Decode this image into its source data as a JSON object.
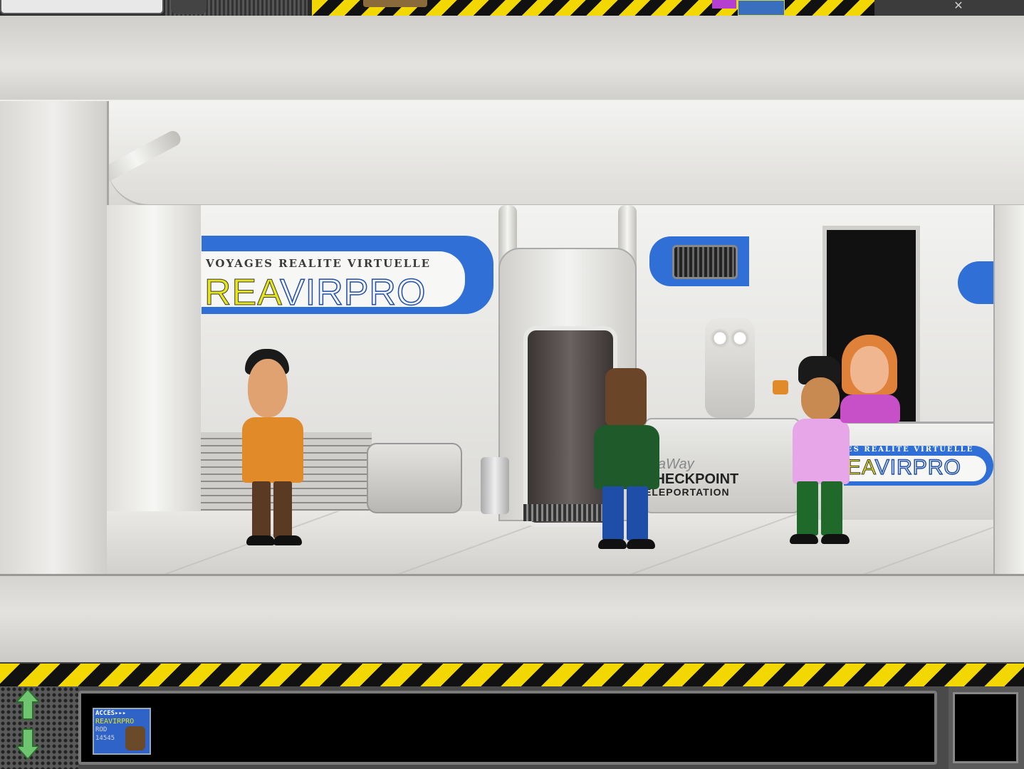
{
  "scene": {
    "sign_left": {
      "subtitle": "VOYAGES REALITE VIRTUELLE",
      "logo_part_1": "REA",
      "logo_part_2": "VIRPRO"
    },
    "sign_right": {
      "subtitle": "ES REALITE VIRTUELLE",
      "logo_part_1": "EA",
      "logo_part_2": "VIRPRO"
    },
    "checkpoint": {
      "brand": "StaWay",
      "title": "CHECKPOINT",
      "subtitle": "ELEPORTATION"
    }
  },
  "inventory": {
    "items": [
      {
        "line1": "ACCES▸▸▸",
        "line2": "REAVIRPRO",
        "line3": "ROD",
        "line4": "14545"
      }
    ]
  },
  "colors": {
    "hazard_yellow": "#f2d800",
    "sign_blue": "#2f6fd6",
    "logo_yellow": "#e5e51a"
  },
  "icons": {
    "scroll_up": "up-arrow-icon",
    "scroll_down": "down-arrow-icon"
  }
}
